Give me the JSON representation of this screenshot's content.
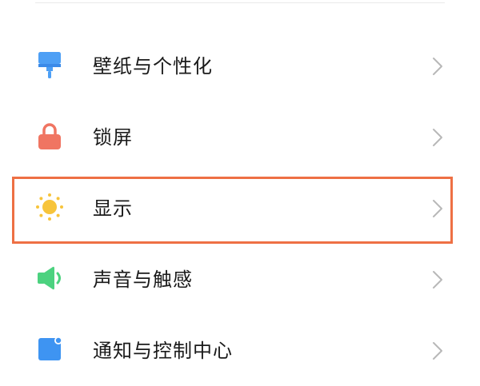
{
  "settings": {
    "items": [
      {
        "label": "壁纸与个性化",
        "icon": "paint-brush-icon",
        "color": "#4d9ff5"
      },
      {
        "label": "锁屏",
        "icon": "lock-icon",
        "color": "#f07562"
      },
      {
        "label": "显示",
        "icon": "sun-icon",
        "color": "#f7c43b",
        "highlighted": true
      },
      {
        "label": "声音与触感",
        "icon": "speaker-icon",
        "color": "#4cd27f"
      },
      {
        "label": "通知与控制中心",
        "icon": "notification-icon",
        "color": "#3e94f2"
      }
    ]
  },
  "colors": {
    "highlight_border": "#ee7044",
    "chevron": "#b8b8b8",
    "divider": "#e9e9e9"
  }
}
